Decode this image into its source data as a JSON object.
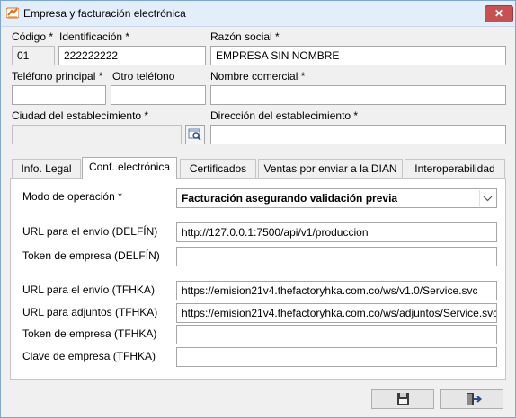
{
  "window": {
    "title": "Empresa y facturación electrónica",
    "close_glyph": "✕"
  },
  "header": {
    "codigo_label": "Código *",
    "codigo_value": "01",
    "identificacion_label": "Identificación *",
    "identificacion_value": "222222222",
    "razon_social_label": "Razón social *",
    "razon_social_value": "EMPRESA SIN NOMBRE",
    "telefono_principal_label": "Teléfono principal *",
    "telefono_principal_value": "",
    "otro_telefono_label": "Otro teléfono",
    "otro_telefono_value": "",
    "nombre_comercial_label": "Nombre comercial *",
    "nombre_comercial_value": "",
    "ciudad_label": "Ciudad del establecimiento *",
    "ciudad_value": "",
    "direccion_label": "Dirección del establecimiento *",
    "direccion_value": ""
  },
  "tabs": [
    "Info. Legal",
    "Conf. electrónica",
    "Certificados",
    "Ventas por enviar a la DIAN",
    "Interoperabilidad"
  ],
  "active_tab": "Conf. electrónica",
  "conf": {
    "modo_label": "Modo de operación *",
    "modo_value": "Facturación asegurando validación previa",
    "url_delfin_label": "URL para el envío (DELFÍN)",
    "url_delfin_value": "http://127.0.0.1:7500/api/v1/produccion",
    "token_delfin_label": "Token de empresa (DELFÍN)",
    "token_delfin_value": "",
    "url_tfhka_label": "URL para el envío (TFHKA)",
    "url_tfhka_value": "https://emision21v4.thefactoryhka.com.co/ws/v1.0/Service.svc",
    "url_adjuntos_label": "URL para adjuntos (TFHKA)",
    "url_adjuntos_value": "https://emision21v4.thefactoryhka.com.co/ws/adjuntos/Service.svc",
    "token_tfhka_label": "Token de empresa (TFHKA)",
    "token_tfhka_value": "",
    "clave_tfhka_label": "Clave de empresa (TFHKA)",
    "clave_tfhka_value": ""
  },
  "icons": {
    "save": "floppy-disk-icon",
    "exit": "exit-door-icon",
    "lookup": "magnifier-lookup-icon",
    "app": "app-logo-icon"
  },
  "colors": {
    "titlebar": "#e3eefb",
    "close": "#c75050",
    "panel": "#ffffff",
    "border": "#a6a6a6"
  }
}
